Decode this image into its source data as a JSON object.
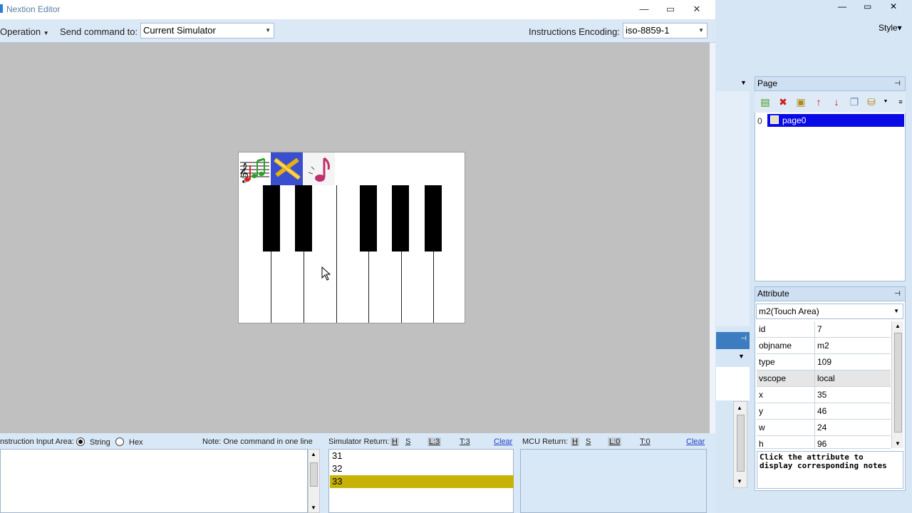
{
  "simulator": {
    "title": "Nextion Editor",
    "window_buttons": {
      "minimize": "—",
      "maximize": "▭",
      "close": "✕"
    }
  },
  "toolbar": {
    "operation_label": "Operation",
    "send_label": "Send command to:",
    "send_value": "Current Simulator",
    "encoding_label": "Instructions Encoding:",
    "encoding_value": "iso-8859-1"
  },
  "bottom": {
    "input_label": "nstruction Input Area:",
    "string_label": "String",
    "hex_label": "Hex",
    "note": "Note: One command in one line",
    "sim_return_label": "Simulator Return:",
    "sim_flags": {
      "h": "H",
      "s": "S",
      "l": "L:3",
      "t": "T:3"
    },
    "sim_clear": "Clear",
    "sim_lines": [
      "31",
      "32",
      "33"
    ],
    "mcu_return_label": "MCU Return:",
    "mcu_flags": {
      "h": "H",
      "s": "S",
      "l": "L:0",
      "t": "T:0"
    },
    "mcu_clear": "Clear"
  },
  "editor": {
    "window_buttons": {
      "minimize": "—",
      "maximize": "▭",
      "close": "✕"
    },
    "style_label": "Style▾",
    "page_panel": {
      "title": "Page",
      "pages": [
        {
          "index": "0",
          "name": "page0"
        }
      ]
    },
    "attribute_panel": {
      "title": "Attribute",
      "selected": "m2(Touch Area)",
      "rows": [
        {
          "key": "id",
          "value": "7"
        },
        {
          "key": "objname",
          "value": "m2"
        },
        {
          "key": "type",
          "value": "109"
        },
        {
          "key": "vscope",
          "value": "local"
        },
        {
          "key": "x",
          "value": "35"
        },
        {
          "key": "y",
          "value": "46"
        },
        {
          "key": "w",
          "value": "24"
        },
        {
          "key": "h",
          "value": "96"
        }
      ],
      "notes": "Click the attribute to display corresponding notes"
    }
  },
  "colors": {
    "selection_blue": "#0a0ae6",
    "return_highlight": "#c7b308",
    "canvas_gray": "#c0c0c0"
  }
}
